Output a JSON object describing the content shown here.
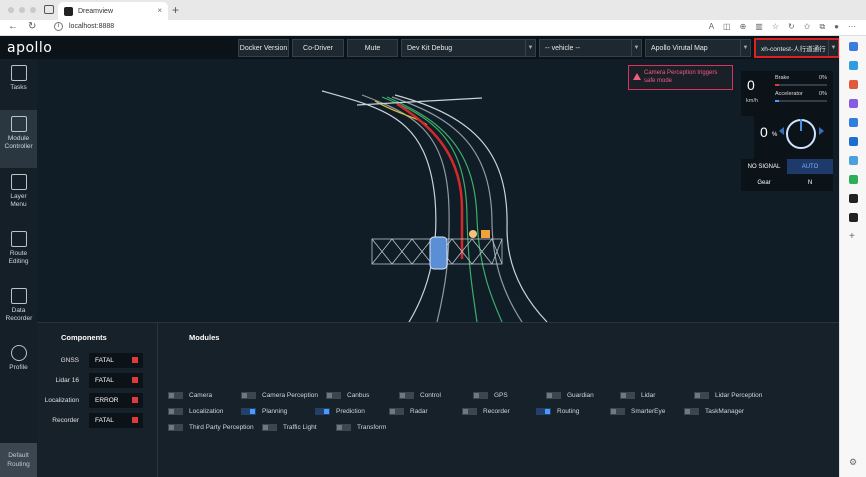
{
  "browser": {
    "tab_title": "Dreamview",
    "tab_close": "×",
    "new_tab": "+",
    "url": "localhost:8888",
    "info_glyph": "i",
    "back": "←",
    "reload": "↻"
  },
  "app": {
    "logo": "apollo",
    "toolbar": {
      "docker_version": "Docker Version",
      "co_driver": "Co-Driver",
      "mute": "Mute",
      "mode": "Dev Kit Debug",
      "vehicle": "-- vehicle --",
      "map": "Apollo Virutal Map",
      "scenario": "xh-contest-人行道通行"
    },
    "sidebar": {
      "items": [
        {
          "label": "Tasks",
          "icon": "tasks-icon"
        },
        {
          "label": "Module Controller",
          "icon": "module-controller-icon"
        },
        {
          "label": "Layer Menu",
          "icon": "layer-menu-icon"
        },
        {
          "label": "Route Editing",
          "icon": "route-editing-icon"
        },
        {
          "label": "Data Recorder",
          "icon": "data-recorder-icon"
        },
        {
          "label": "Profile",
          "icon": "profile-icon"
        }
      ],
      "default_routing": "Default Routing"
    },
    "alert": "Camera Perception triggers safe mode",
    "dashboard": {
      "speed": "0",
      "speed_unit": "km/h",
      "brake_label": "Brake",
      "brake_value": "0%",
      "accelerator_label": "Accelerator",
      "accelerator_value": "0%",
      "steering_value": "0",
      "steering_unit": "%",
      "signal": "NO SIGNAL",
      "drive_mode": "AUTO",
      "gear_label": "Gear",
      "gear_value": "N"
    },
    "components_title": "Components",
    "components": [
      {
        "name": "GNSS",
        "status": "FATAL"
      },
      {
        "name": "Lidar 16",
        "status": "FATAL"
      },
      {
        "name": "Localization",
        "status": "ERROR"
      },
      {
        "name": "Recorder",
        "status": "FATAL"
      }
    ],
    "modules_title": "Modules",
    "modules": [
      {
        "name": "Camera",
        "on": false
      },
      {
        "name": "Camera Perception",
        "on": false
      },
      {
        "name": "Canbus",
        "on": false
      },
      {
        "name": "Control",
        "on": false
      },
      {
        "name": "GPS",
        "on": false
      },
      {
        "name": "Guardian",
        "on": false
      },
      {
        "name": "Lidar",
        "on": false
      },
      {
        "name": "Lidar Perception",
        "on": false
      },
      {
        "name": "Localization",
        "on": false
      },
      {
        "name": "Planning",
        "on": true
      },
      {
        "name": "Prediction",
        "on": true
      },
      {
        "name": "Radar",
        "on": false
      },
      {
        "name": "Recorder",
        "on": false
      },
      {
        "name": "Routing",
        "on": true
      },
      {
        "name": "SmarterEye",
        "on": false
      },
      {
        "name": "TaskManager",
        "on": false
      },
      {
        "name": "Third Party Perception",
        "on": false
      },
      {
        "name": "Traffic Light",
        "on": false
      },
      {
        "name": "Transform",
        "on": false
      }
    ],
    "colors": {
      "fatal": "#e23a3a",
      "toggle_on": "#4a9bff",
      "alert": "#ef5e7e"
    }
  }
}
